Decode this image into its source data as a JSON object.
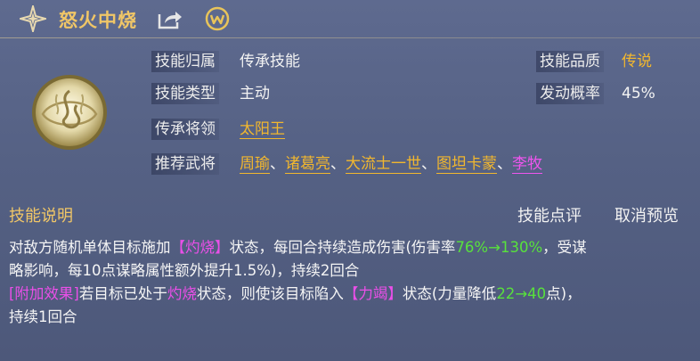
{
  "header": {
    "title": "怒火中烧",
    "icons": [
      "star-icon",
      "share-icon",
      "wechat-icon"
    ]
  },
  "info": {
    "belong_label": "技能归属",
    "belong_value": "传承技能",
    "quality_label": "技能品质",
    "quality_value": "传说",
    "type_label": "技能类型",
    "type_value": "主动",
    "rate_label": "发动概率",
    "rate_value": "45%",
    "inherit_label": "传承将领",
    "inherit_value": "太阳王",
    "recommend_label": "推荐武将",
    "recommend": [
      "周瑜",
      "诸葛亮",
      "大流士一世",
      "图坦卡蒙",
      "李牧"
    ],
    "separator": "、"
  },
  "section": {
    "title": "技能说明",
    "review": "技能点评",
    "cancel_preview": "取消预览"
  },
  "description": {
    "l1_a": "对敌方随机单体目标施加",
    "l1_tag": "【灼烧】",
    "l1_b": "状态，每回合持续造成伤害(伤害率",
    "l1_from": "76%",
    "l1_arrow": "→",
    "l1_to": "130%",
    "l1_c": "，受谋",
    "l2": "略影响，每10点谋略属性额外提升1.5%)，持续2回合",
    "l3_tag": "[附加效果]",
    "l3_a": "若目标已处于",
    "l3_burn": "灼烧",
    "l3_b": "状态，则使该目标陷入",
    "l3_tag2": "【力竭】",
    "l3_c": "状态(力量降低",
    "l3_from": "22",
    "l3_arrow": "→",
    "l3_to": "40",
    "l3_d": "点)，",
    "l4": "持续1回合"
  },
  "colors": {
    "gold": "#f2b72e",
    "purple": "#ee55ee",
    "green": "#58e23c",
    "background": "#556184"
  }
}
